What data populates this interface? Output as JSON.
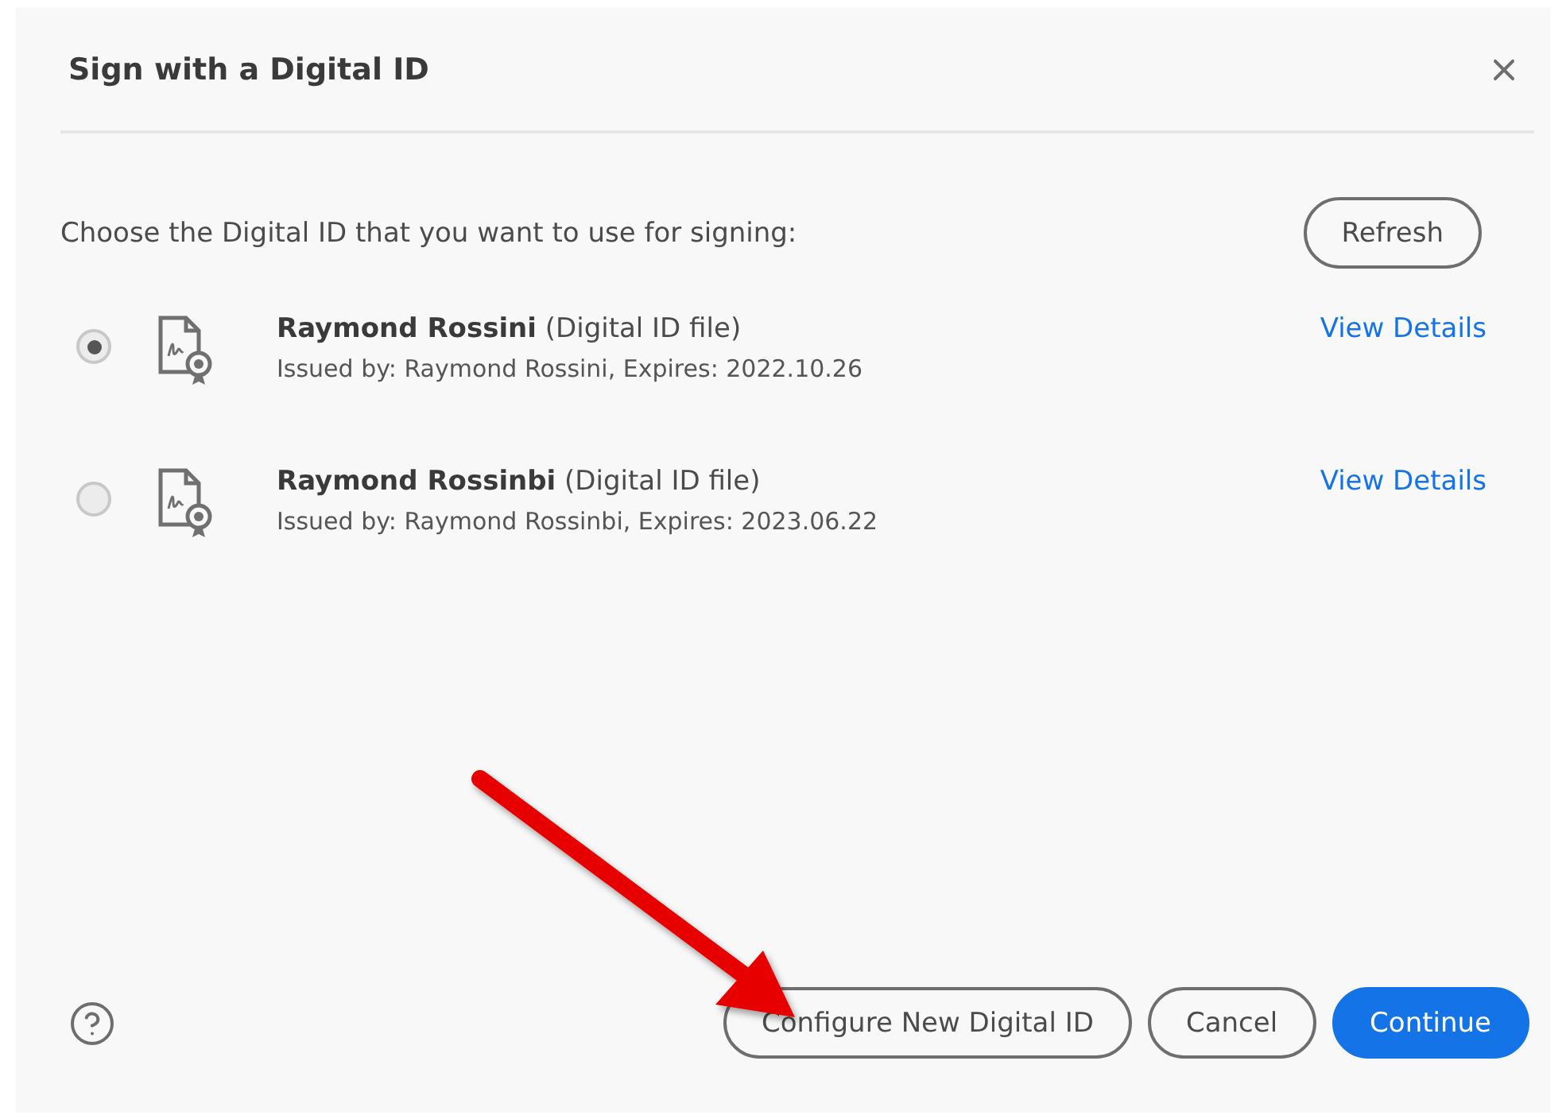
{
  "dialog": {
    "title": "Sign with a Digital ID"
  },
  "prompt": "Choose the Digital ID that you want to use for signing:",
  "refresh_button": "Refresh",
  "ids": [
    {
      "name": "Raymond Rossini",
      "type": "(Digital ID file)",
      "issued": "Issued by: Raymond Rossini, Expires: 2022.10.26",
      "link": "View Details",
      "selected": true
    },
    {
      "name": "Raymond Rossinbi",
      "type": "(Digital ID file)",
      "issued": "Issued by: Raymond Rossinbi, Expires: 2023.06.22",
      "link": "View Details",
      "selected": false
    }
  ],
  "buttons": [
    {
      "label": "Configure New Digital ID",
      "kind": "secondary"
    },
    {
      "label": "Cancel",
      "kind": "secondary"
    },
    {
      "label": "Continue",
      "kind": "primary"
    }
  ]
}
